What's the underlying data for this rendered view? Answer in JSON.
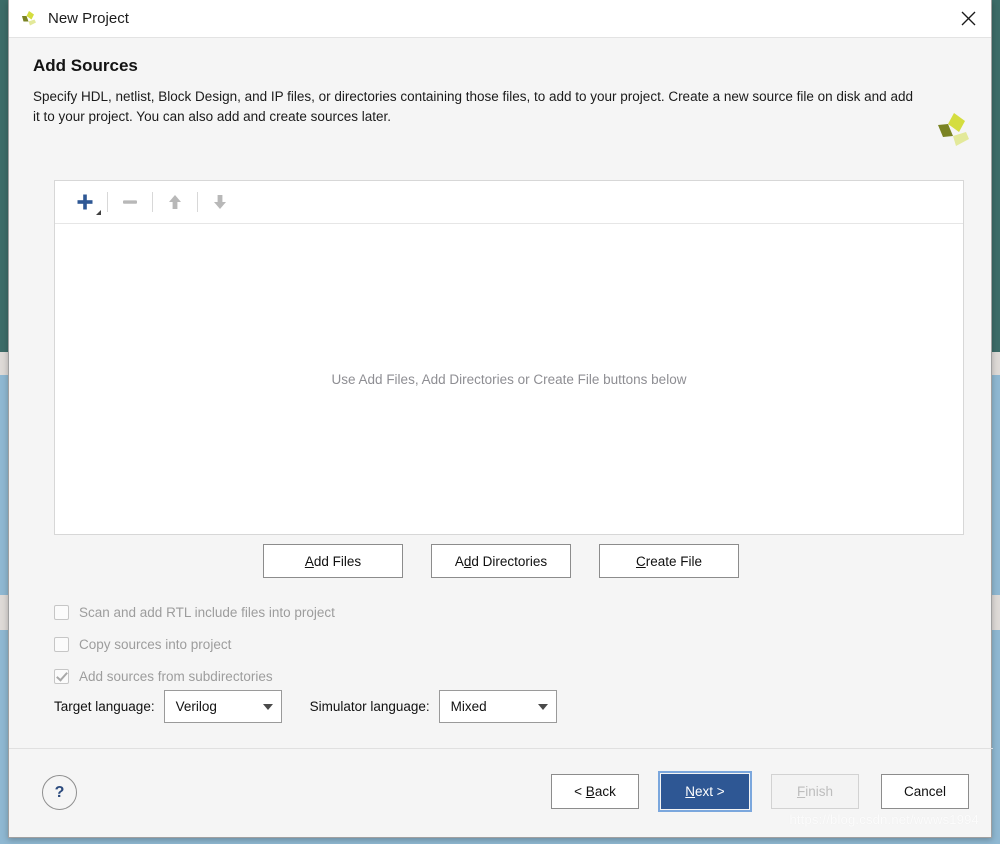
{
  "window": {
    "title": "New Project",
    "logo_icon": "xilinx-logo-icon",
    "close_icon": "close-icon"
  },
  "header": {
    "title": "Add Sources",
    "description": "Specify HDL, netlist, Block Design, and IP files, or directories containing those files, to add to your project. Create a new source file on disk and add it to your project. You can also add and create sources later.",
    "logo_icon": "xilinx-logo-icon"
  },
  "source_panel": {
    "toolbar": [
      {
        "name": "add-source-button",
        "icon": "plus-icon",
        "enabled": true,
        "has_dropdown": true
      },
      {
        "name": "remove-source-button",
        "icon": "minus-icon",
        "enabled": false
      },
      {
        "name": "move-up-button",
        "icon": "arrow-up-icon",
        "enabled": false
      },
      {
        "name": "move-down-button",
        "icon": "arrow-down-icon",
        "enabled": false
      }
    ],
    "empty_message": "Use Add Files, Add Directories or Create File buttons below"
  },
  "add_buttons": {
    "add_files": {
      "pre": "A",
      "mnemonic": "",
      "label": "Add Files",
      "mn_index": 0
    },
    "add_directories": {
      "label": "Add Directories",
      "mn_index": 2
    },
    "create_file": {
      "label": "Create File",
      "mn_index": 0
    }
  },
  "add_buttons_text": {
    "add_files": "Add Files",
    "add_directories": "Add Directories",
    "create_file": "Create File"
  },
  "options": [
    {
      "label": "Scan and add RTL include files into project",
      "checked": false,
      "enabled": false
    },
    {
      "label": "Copy sources into project",
      "checked": false,
      "enabled": false
    },
    {
      "label": "Add sources from subdirectories",
      "checked": true,
      "enabled": false
    }
  ],
  "languages": {
    "target_label": "Target language:",
    "target_value": "Verilog",
    "simulator_label": "Simulator language:",
    "simulator_value": "Mixed"
  },
  "footer": {
    "help_label": "?",
    "back_label": "< Back",
    "next_label": "Next >",
    "finish_label": "Finish",
    "cancel_label": "Cancel"
  },
  "watermark": "https://blog.csdn.net/wwws1994",
  "colors": {
    "accent_blue": "#2e5794",
    "focus_ring": "#7ba7dd",
    "logo_dark": "#7a8323",
    "logo_mid": "#d4dd3f",
    "logo_light": "#e3e99a",
    "desktop_teal": "#3d6c68",
    "desktop_blue": "#8fb8d2",
    "desktop_gray": "#dedad7"
  }
}
